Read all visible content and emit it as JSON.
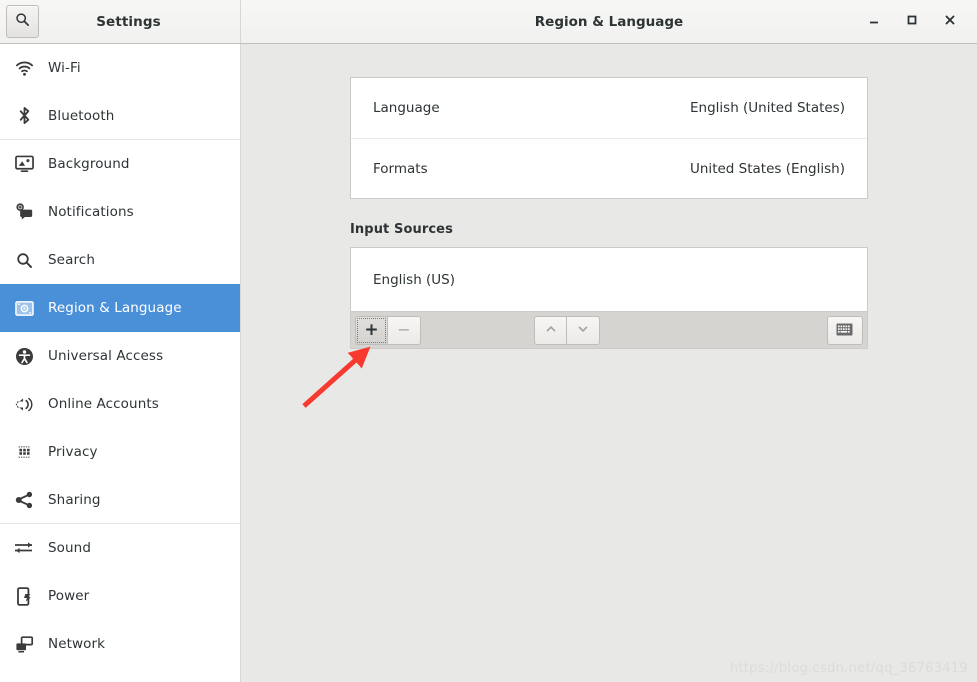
{
  "window": {
    "app_title": "Settings",
    "page_title": "Region & Language",
    "search_icon": "search-icon",
    "controls": {
      "minimize": "minimize-icon",
      "maximize": "maximize-icon",
      "close": "close-icon"
    }
  },
  "sidebar": {
    "items": [
      {
        "label": "Wi-Fi",
        "icon": "wifi-icon",
        "selected": false,
        "separator_after": false
      },
      {
        "label": "Bluetooth",
        "icon": "bluetooth-icon",
        "selected": false,
        "separator_after": true
      },
      {
        "label": "Background",
        "icon": "background-icon",
        "selected": false,
        "separator_after": false
      },
      {
        "label": "Notifications",
        "icon": "notifications-icon",
        "selected": false,
        "separator_after": false
      },
      {
        "label": "Search",
        "icon": "search-icon",
        "selected": false,
        "separator_after": false
      },
      {
        "label": "Region & Language",
        "icon": "region-language-icon",
        "selected": true,
        "separator_after": false
      },
      {
        "label": "Universal Access",
        "icon": "universal-access-icon",
        "selected": false,
        "separator_after": false
      },
      {
        "label": "Online Accounts",
        "icon": "online-accounts-icon",
        "selected": false,
        "separator_after": false
      },
      {
        "label": "Privacy",
        "icon": "privacy-icon",
        "selected": false,
        "separator_after": false
      },
      {
        "label": "Sharing",
        "icon": "sharing-icon",
        "selected": false,
        "separator_after": true
      },
      {
        "label": "Sound",
        "icon": "sound-icon",
        "selected": false,
        "separator_after": false
      },
      {
        "label": "Power",
        "icon": "power-icon",
        "selected": false,
        "separator_after": false
      },
      {
        "label": "Network",
        "icon": "network-icon",
        "selected": false,
        "separator_after": false
      }
    ]
  },
  "main": {
    "settings_rows": [
      {
        "label": "Language",
        "value": "English (United States)"
      },
      {
        "label": "Formats",
        "value": "United States (English)"
      }
    ],
    "input_sources": {
      "title": "Input Sources",
      "items": [
        {
          "label": "English (US)"
        }
      ],
      "toolbar": {
        "add_label": "+",
        "remove_label": "−",
        "move_up_icon": "chevron-up-icon",
        "move_down_icon": "chevron-down-icon",
        "keyboard_icon": "keyboard-icon"
      }
    }
  },
  "annotation": {
    "arrow": "red-arrow-pointing-to-add-button",
    "color": "#f8392f"
  },
  "watermark": "https://blog.csdn.net/qq_36763419",
  "colors": {
    "accent": "#4a90d9",
    "content_bg": "#e8e8e7",
    "sidebar_bg": "#ffffff",
    "toolbar_bg": "#d6d4d1"
  }
}
